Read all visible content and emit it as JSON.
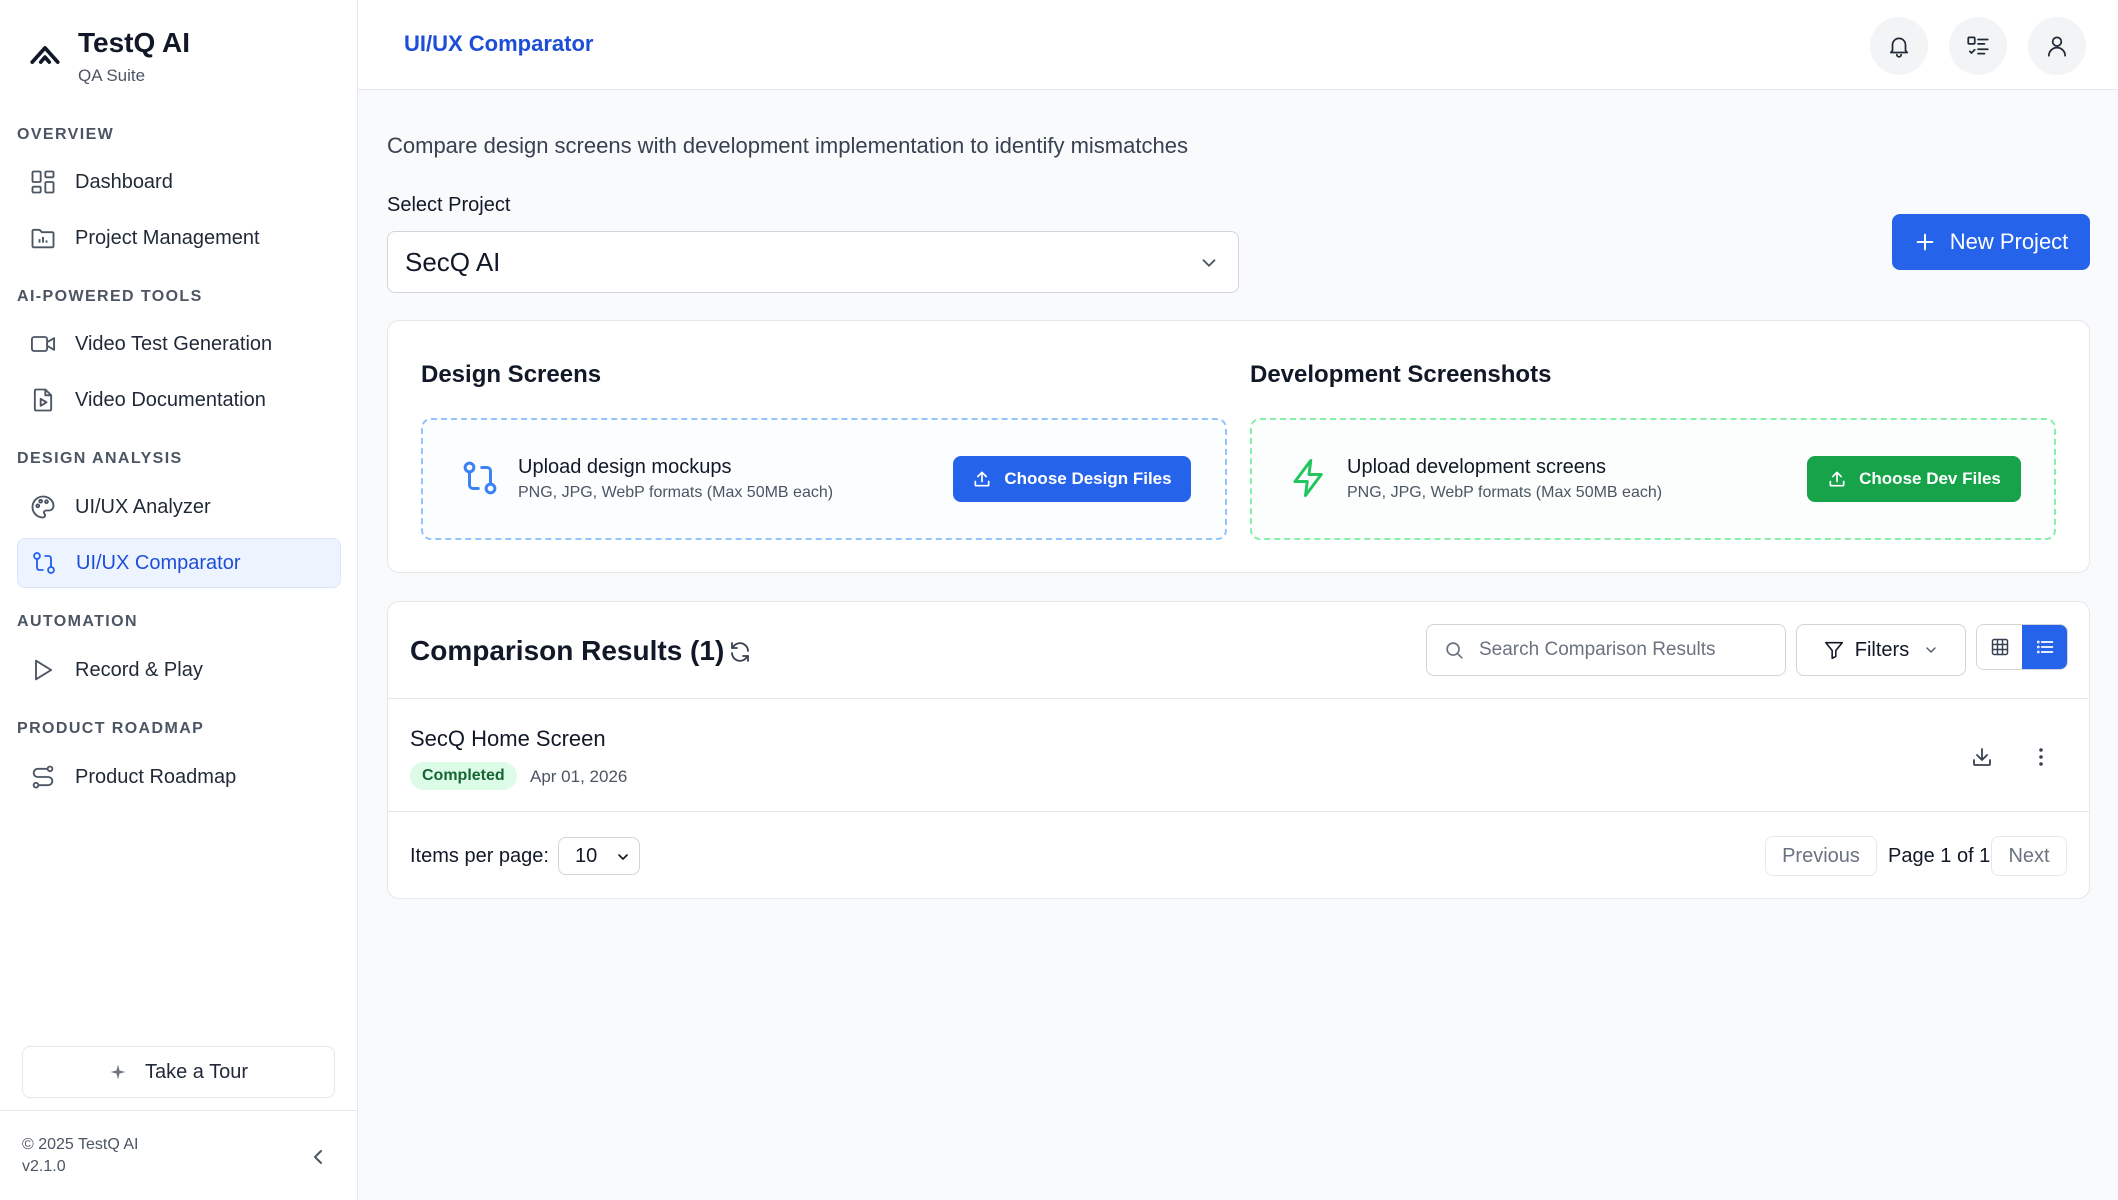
{
  "brand": {
    "name": "TestQ AI",
    "subtitle": "QA Suite"
  },
  "sidebar": {
    "sections": [
      {
        "title": "OVERVIEW",
        "items": [
          {
            "label": "Dashboard",
            "icon": "dashboard-icon"
          },
          {
            "label": "Project Management",
            "icon": "folder-chart-icon"
          }
        ]
      },
      {
        "title": "AI-POWERED TOOLS",
        "items": [
          {
            "label": "Video Test Generation",
            "icon": "video-camera-icon"
          },
          {
            "label": "Video Documentation",
            "icon": "file-play-icon"
          }
        ]
      },
      {
        "title": "DESIGN ANALYSIS",
        "items": [
          {
            "label": "UI/UX Analyzer",
            "icon": "palette-icon"
          },
          {
            "label": "UI/UX Comparator",
            "icon": "git-compare-icon",
            "active": true
          }
        ]
      },
      {
        "title": "AUTOMATION",
        "items": [
          {
            "label": "Record & Play",
            "icon": "play-icon"
          }
        ]
      },
      {
        "title": "PRODUCT ROADMAP",
        "items": [
          {
            "label": "Product Roadmap",
            "icon": "route-icon"
          }
        ]
      }
    ],
    "tour_label": "Take a Tour",
    "copyright": "© 2025 TestQ AI",
    "version": "v2.1.0"
  },
  "topbar": {
    "title": "UI/UX Comparator",
    "icons": [
      "bell-icon",
      "checklist-icon",
      "user-icon"
    ]
  },
  "main": {
    "description": "Compare design screens with development implementation to identify mismatches",
    "select_label": "Select Project",
    "selected_project": "SecQ AI",
    "new_project_label": "New Project",
    "design": {
      "title": "Design Screens",
      "upload_title": "Upload design mockups",
      "upload_hint": "PNG, JPG, WebP formats (Max 50MB each)",
      "button_label": "Choose Design Files"
    },
    "dev": {
      "title": "Development Screenshots",
      "upload_title": "Upload development screens",
      "upload_hint": "PNG, JPG, WebP formats (Max 50MB each)",
      "button_label": "Choose Dev Files"
    },
    "results": {
      "title": "Comparison Results (1)",
      "search_placeholder": "Search Comparison Results",
      "filters_label": "Filters",
      "items": [
        {
          "name": "SecQ Home Screen",
          "status": "Completed",
          "date": "Apr 01, 2026"
        }
      ],
      "items_per_page_label": "Items per page:",
      "items_per_page": "10",
      "prev_label": "Previous",
      "page_info": "Page 1 of 1",
      "next_label": "Next"
    }
  },
  "colors": {
    "primary": "#2563eb",
    "success": "#16a34a",
    "active_bg": "#eef4ff",
    "badge_bg": "#dcfce7"
  }
}
